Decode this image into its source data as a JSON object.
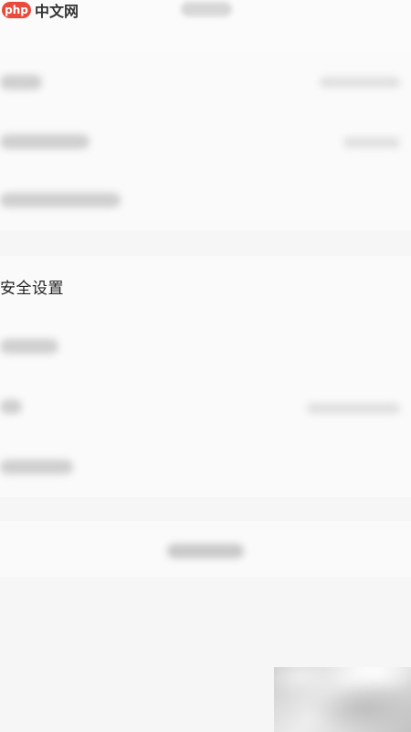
{
  "brand": {
    "badge": "php",
    "site": "中文网"
  },
  "security": {
    "title": "安全设置"
  },
  "colors": {
    "page_bg": "#f6f6f6",
    "row_bg": "#fafafa",
    "brand_red": "#e84b3c"
  }
}
